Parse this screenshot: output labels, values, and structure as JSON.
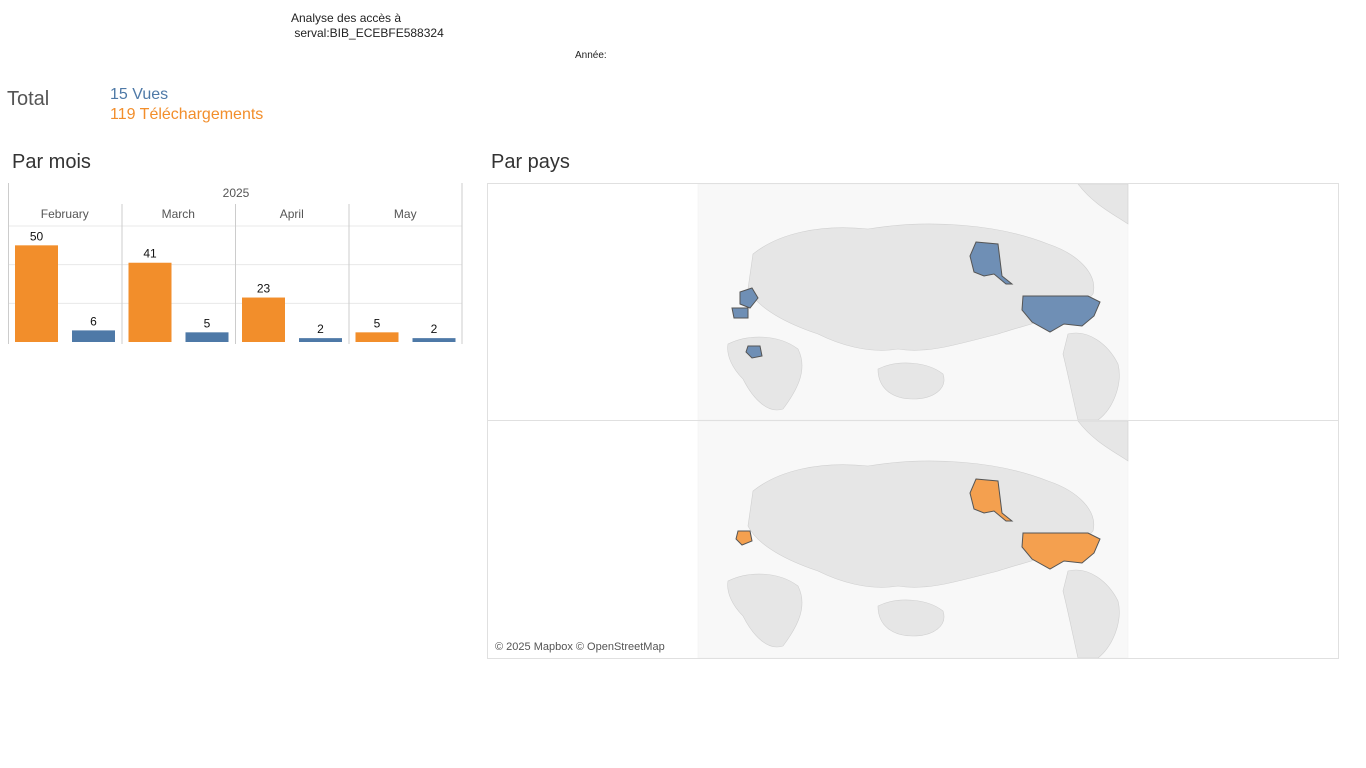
{
  "header": {
    "title": "Analyse des accès à\n serval:BIB_ECEBFE588324",
    "year_filter_label": "Année:"
  },
  "totals": {
    "label": "Total",
    "views": "15 Vues",
    "downloads": "119 Téléchargements"
  },
  "sections": {
    "by_month": "Par mois",
    "by_country": "Par pays"
  },
  "colors": {
    "downloads": "#f28e2b",
    "views": "#4e79a7",
    "views_map": "#6f8fb5",
    "downloads_map": "#f4a04f",
    "land": "#e6e6e6",
    "gridline": "#e8e8e8",
    "divider": "#cccccc"
  },
  "chart_data": {
    "type": "bar",
    "year": "2025",
    "categories": [
      "February",
      "March",
      "April",
      "May"
    ],
    "series": [
      {
        "values": [
          50,
          41,
          23,
          5
        ],
        "color_key": "downloads"
      },
      {
        "values": [
          6,
          5,
          2,
          2
        ],
        "color_key": "views"
      }
    ],
    "ylim": [
      0,
      60
    ],
    "grid": true,
    "data_labels": true
  },
  "maps": {
    "views_countries": [
      "France",
      "Spain",
      "Nigeria",
      "United States"
    ],
    "downloads_countries": [
      "France",
      "United States"
    ],
    "attribution": "© 2025 Mapbox © OpenStreetMap"
  }
}
